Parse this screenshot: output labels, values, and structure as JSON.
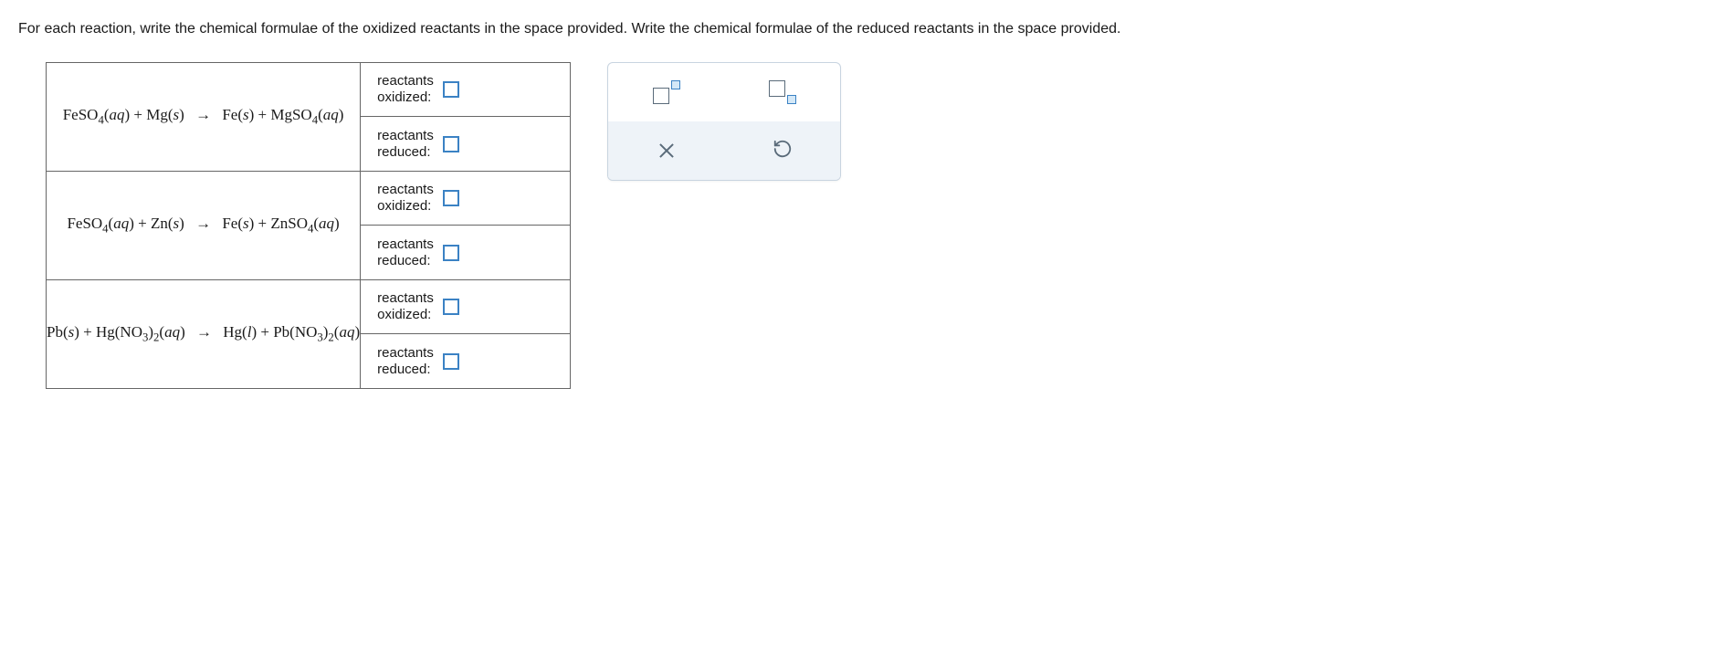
{
  "instructions": "For each reaction, write the chemical formulae of the oxidized reactants in the space provided. Write the chemical formulae of the reduced reactants in the space provided.",
  "labels": {
    "oxidized": "reactants oxidized:",
    "reduced": "reactants reduced:"
  },
  "reactions": [
    {
      "equation_html": "FeSO<sub>4</sub>(<span class='state'>aq</span>) + Mg(<span class='state'>s</span>) <span class='arrow'>→</span> Fe(<span class='state'>s</span>) + MgSO<sub>4</sub>(<span class='state'>aq</span>)"
    },
    {
      "equation_html": "FeSO<sub>4</sub>(<span class='state'>aq</span>) + Zn(<span class='state'>s</span>) <span class='arrow'>→</span> Fe(<span class='state'>s</span>) + ZnSO<sub>4</sub>(<span class='state'>aq</span>)"
    },
    {
      "equation_html": "Pb(<span class='state'>s</span>) + Hg(NO<sub>3</sub>)<sub>2</sub>(<span class='state'>aq</span>) <span class='arrow'>→</span> Hg(<span class='state'>l</span>) + Pb(NO<sub>3</sub>)<sub>2</sub>(<span class='state'>aq</span>)"
    }
  ],
  "toolbox": {
    "superscript": "superscript",
    "subscript": "subscript",
    "clear": "clear",
    "reset": "reset"
  }
}
